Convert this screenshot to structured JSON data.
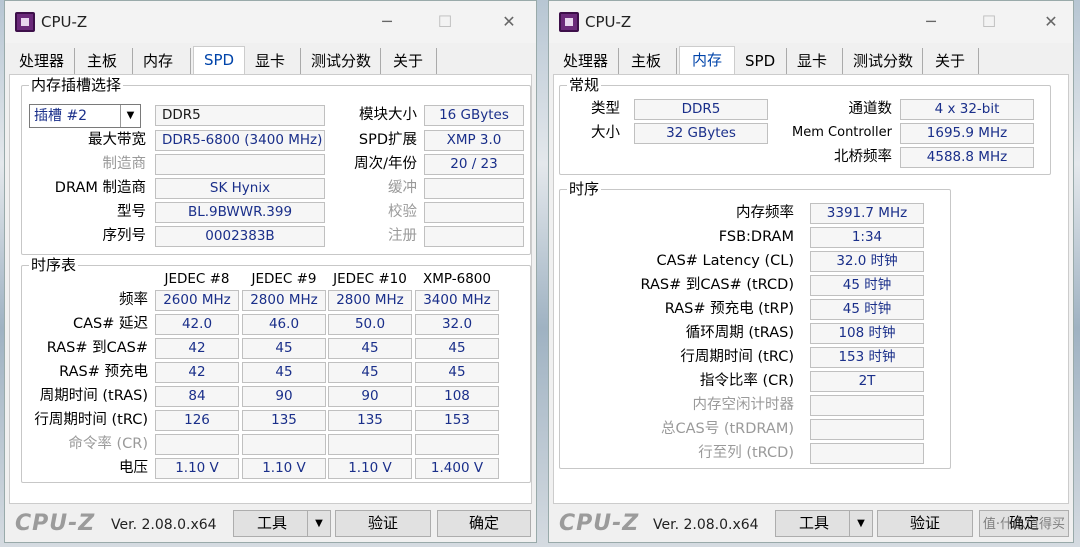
{
  "left": {
    "title": "CPU-Z",
    "tabs": [
      "处理器",
      "主板",
      "内存",
      "SPD",
      "显卡",
      "测试分数",
      "关于"
    ],
    "slot_group_title": "内存插槽选择",
    "slot_select": "插槽 #2",
    "memory_type": "DDR5",
    "module_size_label": "模块大小",
    "module_size": "16 GBytes",
    "max_bw_label": "最大带宽",
    "max_bw": "DDR5-6800 (3400 MHz)",
    "spd_ext_label": "SPD扩展",
    "spd_ext": "XMP 3.0",
    "mfr_label": "制造商",
    "mfr": "",
    "week_year_label": "周次/年份",
    "week_year": "20 / 23",
    "dram_mfr_label": "DRAM 制造商",
    "dram_mfr": "SK Hynix",
    "buffered_label": "缓冲",
    "buffered": "",
    "part_label": "型号",
    "part": "BL.9BWWR.399",
    "correction_label": "校验",
    "correction": "",
    "serial_label": "序列号",
    "serial": "0002383B",
    "registered_label": "注册",
    "registered": "",
    "timing_group_title": "时序表",
    "timing_cols": [
      "JEDEC #8",
      "JEDEC #9",
      "JEDEC #10",
      "XMP-6800"
    ],
    "timing_rows": [
      {
        "label": "频率",
        "values": [
          "2600 MHz",
          "2800 MHz",
          "2800 MHz",
          "3400 MHz"
        ],
        "dim": false
      },
      {
        "label": "CAS# 延迟",
        "values": [
          "42.0",
          "46.0",
          "50.0",
          "32.0"
        ],
        "dim": false
      },
      {
        "label": "RAS# 到CAS#",
        "values": [
          "42",
          "45",
          "45",
          "45"
        ],
        "dim": false
      },
      {
        "label": "RAS# 预充电",
        "values": [
          "42",
          "45",
          "45",
          "45"
        ],
        "dim": false
      },
      {
        "label": "周期时间 (tRAS)",
        "values": [
          "84",
          "90",
          "90",
          "108"
        ],
        "dim": false
      },
      {
        "label": "行周期时间 (tRC)",
        "values": [
          "126",
          "135",
          "135",
          "153"
        ],
        "dim": false
      },
      {
        "label": "命令率 (CR)",
        "values": [
          "",
          "",
          "",
          ""
        ],
        "dim": true
      },
      {
        "label": "电压",
        "values": [
          "1.10 V",
          "1.10 V",
          "1.10 V",
          "1.400 V"
        ],
        "dim": false
      }
    ],
    "logo": "CPU-Z",
    "version": "Ver. 2.08.0.x64",
    "tools": "工具",
    "validate": "验证",
    "ok": "确定"
  },
  "right": {
    "title": "CPU-Z",
    "tabs": [
      "处理器",
      "主板",
      "内存",
      "SPD",
      "显卡",
      "测试分数",
      "关于"
    ],
    "general_title": "常规",
    "type_label": "类型",
    "type": "DDR5",
    "channels_label": "通道数",
    "channels": "4 x 32-bit",
    "size_label": "大小",
    "size": "32 GBytes",
    "memctrl_label": "Mem Controller",
    "memctrl": "1695.9 MHz",
    "nb_label": "北桥频率",
    "nb": "4588.8 MHz",
    "timings_title": "时序",
    "rows": [
      {
        "label": "内存频率",
        "value": "3391.7 MHz",
        "dim": false
      },
      {
        "label": "FSB:DRAM",
        "value": "1:34",
        "dim": false
      },
      {
        "label": "CAS# Latency (CL)",
        "value": "32.0 时钟",
        "dim": false
      },
      {
        "label": "RAS# 到CAS# (tRCD)",
        "value": "45 时钟",
        "dim": false
      },
      {
        "label": "RAS# 预充电 (tRP)",
        "value": "45 时钟",
        "dim": false
      },
      {
        "label": "循环周期 (tRAS)",
        "value": "108 时钟",
        "dim": false
      },
      {
        "label": "行周期时间 (tRC)",
        "value": "153 时钟",
        "dim": false
      },
      {
        "label": "指令比率 (CR)",
        "value": "2T",
        "dim": false
      },
      {
        "label": "内存空闲计时器",
        "value": "",
        "dim": true
      },
      {
        "label": "总CAS号 (tRDRAM)",
        "value": "",
        "dim": true
      },
      {
        "label": "行至列 (tRCD)",
        "value": "",
        "dim": true
      }
    ],
    "logo": "CPU-Z",
    "version": "Ver. 2.08.0.x64",
    "tools": "工具",
    "validate": "验证",
    "ok": "确定",
    "watermark": "值·什么值得买"
  }
}
